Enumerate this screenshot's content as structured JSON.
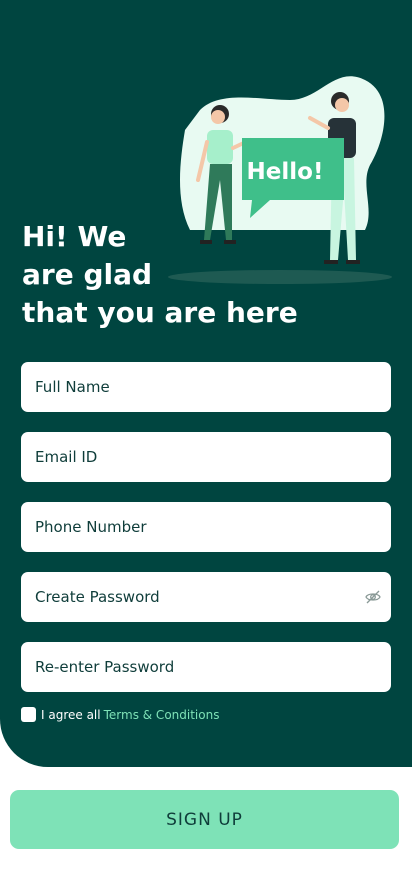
{
  "heading": {
    "line1": "Hi! We",
    "line2": "are glad",
    "line3": "that you are here"
  },
  "illustration": {
    "bubble_text": "Hello!"
  },
  "fields": {
    "full_name": {
      "placeholder": "Full Name"
    },
    "email": {
      "placeholder": "Email ID"
    },
    "phone": {
      "placeholder": "Phone Number"
    },
    "create_password": {
      "placeholder": "Create Password"
    },
    "reenter_password": {
      "placeholder": "Re-enter Password"
    }
  },
  "agreement": {
    "label": "I agree all",
    "link": "Terms & Conditions"
  },
  "signup_button": {
    "label": "SIGN UP"
  },
  "colors": {
    "background": "#004540",
    "accent": "#7ee2b7",
    "text_dark": "#0f3d3a"
  },
  "icons": {
    "password_toggle": "eye-slash-icon"
  }
}
